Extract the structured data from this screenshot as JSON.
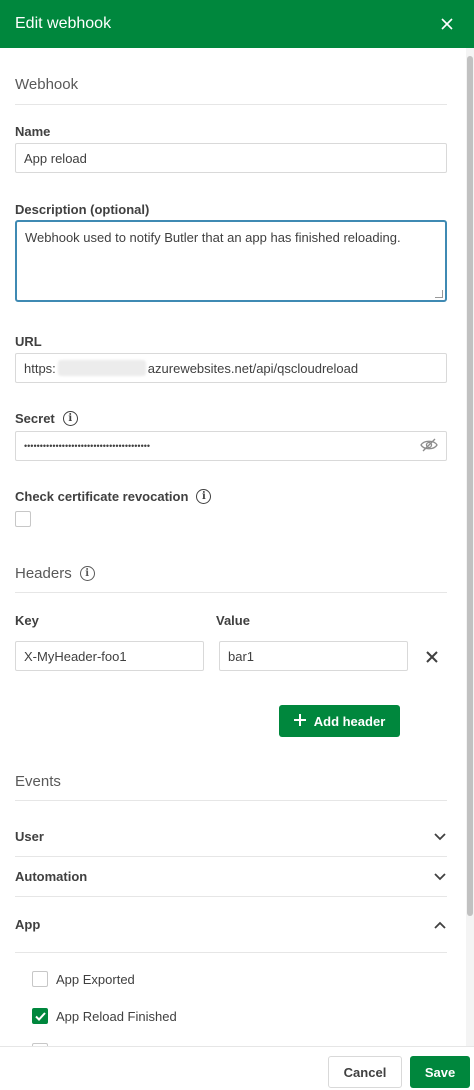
{
  "dialog": {
    "title": "Edit webhook"
  },
  "webhook_section": {
    "title": "Webhook"
  },
  "name": {
    "label": "Name",
    "value": "App reload"
  },
  "description": {
    "label": "Description (optional)",
    "value": "Webhook used to notify Butler that an app has finished reloading."
  },
  "url": {
    "label": "URL",
    "prefix": "https:",
    "suffix": "azurewebsites.net/api/qscloudreload"
  },
  "secret": {
    "label": "Secret",
    "value": "••••••••••••••••••••••••••••••••••••••••"
  },
  "cert_revocation": {
    "label": "Check certificate revocation",
    "checked": false
  },
  "headers": {
    "title": "Headers",
    "key_label": "Key",
    "value_label": "Value",
    "rows": [
      {
        "key": "X-MyHeader-foo1",
        "value": "bar1"
      }
    ],
    "add_label": "Add header"
  },
  "events": {
    "title": "Events",
    "groups": [
      {
        "label": "User",
        "expanded": false
      },
      {
        "label": "Automation",
        "expanded": false
      },
      {
        "label": "App",
        "expanded": true
      }
    ],
    "app_items": [
      {
        "label": "App Exported",
        "checked": false
      },
      {
        "label": "App Reload Finished",
        "checked": true
      }
    ]
  },
  "footer": {
    "cancel_label": "Cancel",
    "save_label": "Save"
  },
  "colors": {
    "brand": "#00873d",
    "focus": "#3f8ab3"
  },
  "icons": [
    "close-icon",
    "info-icon",
    "eye-slash-icon",
    "plus-icon",
    "chevron-down-icon",
    "chevron-up-icon",
    "checkmark-icon"
  ]
}
